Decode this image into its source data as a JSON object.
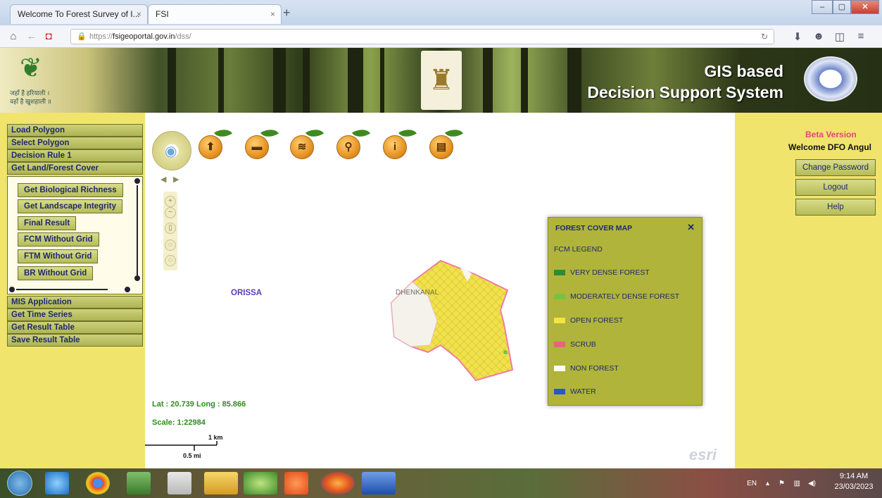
{
  "browser": {
    "tabs": [
      {
        "label": "Welcome To Forest Survey of I..."
      },
      {
        "label": "FSI"
      }
    ],
    "url_prefix": "https://",
    "url_domain": "fsigeoportal.gov.in",
    "url_path": "/dss/"
  },
  "header": {
    "left_logo_text_1": "जहाँ है हरियाली ।",
    "left_logo_text_2": "वहाँ है खुशहाली ॥",
    "title_line_1": "GIS based",
    "title_line_2": "Decision Support System"
  },
  "sidebar": {
    "top_items": [
      {
        "label": "Load Polygon"
      },
      {
        "label": "Select Polygon"
      },
      {
        "label": "Decision Rule 1"
      },
      {
        "label": "Get Land/Forest Cover"
      }
    ],
    "submenu": [
      {
        "label": "Get Biological Richness"
      },
      {
        "label": "Get Landscape Integrity"
      },
      {
        "label": "Final Result"
      },
      {
        "label": "FCM Without Grid"
      },
      {
        "label": "FTM Without Grid"
      },
      {
        "label": "BR Without Grid"
      }
    ],
    "bottom_items": [
      {
        "label": "MIS Application"
      },
      {
        "label": "Get Time Series"
      },
      {
        "label": "Get Result Table"
      },
      {
        "label": "Save Result Table"
      }
    ]
  },
  "right_panel": {
    "beta": "Beta Version",
    "welcome": "Welcome DFO Angul",
    "buttons": [
      {
        "label": "Change Password"
      },
      {
        "label": "Logout"
      },
      {
        "label": "Help"
      }
    ]
  },
  "map": {
    "tools": [
      {
        "icon": "add-layer-icon",
        "glyph": "⬆"
      },
      {
        "icon": "draw-icon",
        "glyph": "▬"
      },
      {
        "icon": "layers-icon",
        "glyph": "≋"
      },
      {
        "icon": "search-icon",
        "glyph": "⚲"
      },
      {
        "icon": "info-icon",
        "glyph": "i"
      },
      {
        "icon": "print-icon",
        "glyph": "▤"
      }
    ],
    "region_label": "ORISSA",
    "place_label": "DHENKANAL",
    "lat_long": "Lat : 20.739 Long : 85.866",
    "scale": "Scale: 1:22984",
    "scalebar_km": "1 km",
    "scalebar_mi": "0.5 mi",
    "esri": "esri"
  },
  "legend": {
    "title": "FOREST COVER MAP",
    "close": "✕",
    "subtitle": "FCM LEGEND",
    "items": [
      {
        "label": "VERY DENSE FOREST",
        "color": "#2e8b3a"
      },
      {
        "label": "MODERATELY DENSE FOREST",
        "color": "#74c443"
      },
      {
        "label": "OPEN FOREST",
        "color": "#f4e340"
      },
      {
        "label": "SCRUB",
        "color": "#e8647e"
      },
      {
        "label": "NON FOREST",
        "color": "#ffffff"
      },
      {
        "label": "WATER",
        "color": "#2b57c6"
      }
    ]
  },
  "taskbar": {
    "language": "EN",
    "time": "9:14 AM",
    "date": "23/03/2023"
  }
}
